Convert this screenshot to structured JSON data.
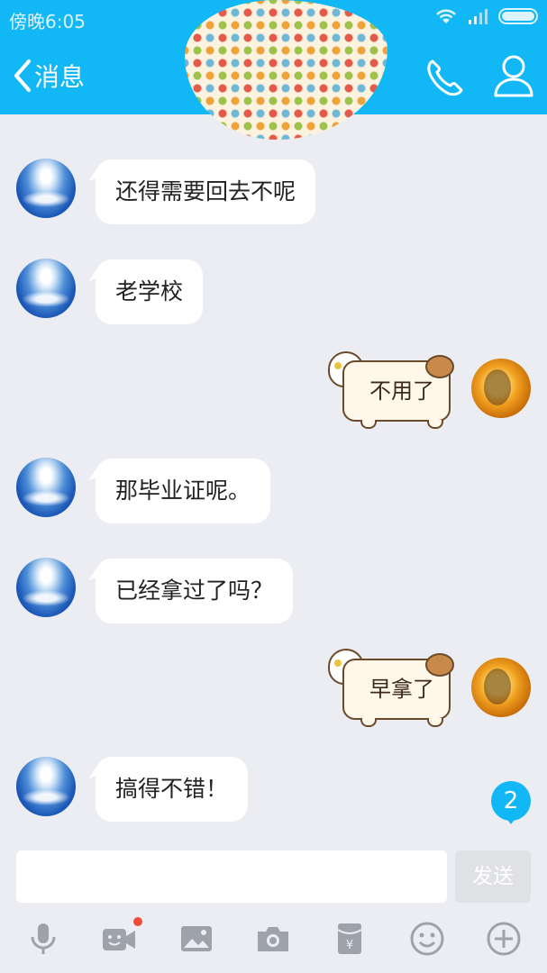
{
  "status_bar": {
    "time": "傍晚6:05"
  },
  "nav": {
    "back_label": "消息"
  },
  "messages": [
    {
      "side": "left",
      "text": "还得需要回去不呢"
    },
    {
      "side": "left",
      "text": "老学校"
    },
    {
      "side": "right",
      "text": "不用了"
    },
    {
      "side": "left",
      "text": "那毕业证呢。"
    },
    {
      "side": "left",
      "text": "已经拿过了吗？"
    },
    {
      "side": "right",
      "text": "早拿了"
    },
    {
      "side": "left",
      "text": "搞得不错！"
    }
  ],
  "unread_count": "2",
  "input": {
    "value": "",
    "send_label": "发送"
  },
  "toolbar_icons": [
    "microphone-icon",
    "video-call-icon",
    "image-icon",
    "camera-icon",
    "red-packet-icon",
    "emoji-icon",
    "plus-icon"
  ],
  "colors": {
    "accent": "#12b7f5",
    "background": "#ebedf2"
  }
}
